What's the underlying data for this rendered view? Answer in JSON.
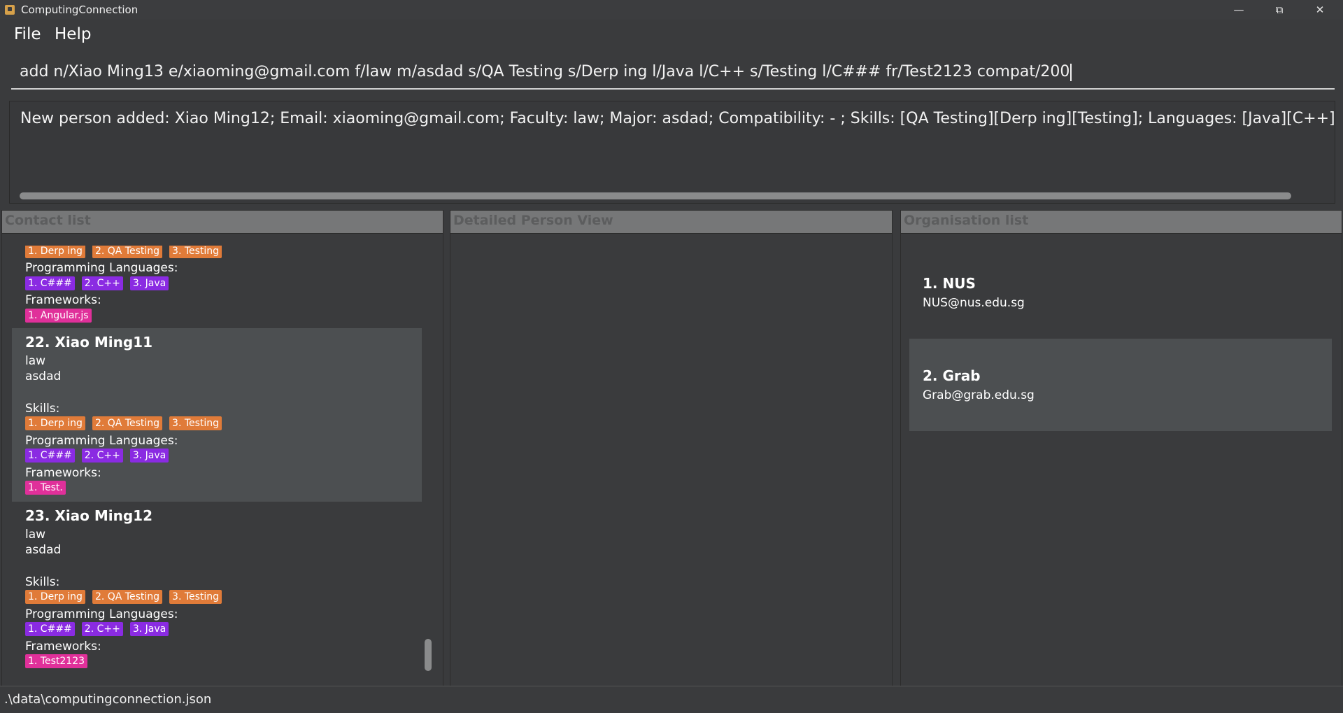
{
  "window": {
    "title": "ComputingConnection",
    "minimize_icon": "minimize-icon",
    "maximize_icon": "restore-icon",
    "close_icon": "close-icon"
  },
  "menu": {
    "file": "File",
    "help": "Help"
  },
  "command": {
    "value": "add n/Xiao Ming13 e/xiaoming@gmail.com f/law m/asdad s/QA Testing s/Derp ing l/Java l/C++ s/Testing l/C### fr/Test2123 compat/200"
  },
  "result": {
    "text": "New person added: Xiao Ming12; Email: xiaoming@gmail.com; Faculty: law; Major: asdad; Compatibility:  - ; Skills: [QA Testing][Derp ing][Testing]; Languages: [Java][C++][C###]; Frameworks: [Test"
  },
  "panels": {
    "contact_list": "Contact list",
    "detail_view": "Detailed Person View",
    "org_list": "Organisation list"
  },
  "partial_contact": {
    "skills": [
      "1. Derp ing",
      "2. QA Testing",
      "3. Testing"
    ],
    "languages_label": "Programming Languages:",
    "languages": [
      "1. C###",
      "2. C++",
      "3. Java"
    ],
    "frameworks_label": "Frameworks:",
    "frameworks": [
      "1. Angular.js"
    ]
  },
  "contacts": [
    {
      "name": "22.  Xiao Ming11",
      "faculty": "law",
      "major": "asdad",
      "skills_label": "Skills:",
      "skills": [
        "1. Derp ing",
        "2. QA Testing",
        "3. Testing"
      ],
      "languages_label": "Programming Languages:",
      "languages": [
        "1. C###",
        "2. C++",
        "3. Java"
      ],
      "frameworks_label": "Frameworks:",
      "frameworks": [
        "1. Test."
      ]
    },
    {
      "name": "23.  Xiao Ming12",
      "faculty": "law",
      "major": "asdad",
      "skills_label": "Skills:",
      "skills": [
        "1. Derp ing",
        "2. QA Testing",
        "3. Testing"
      ],
      "languages_label": "Programming Languages:",
      "languages": [
        "1. C###",
        "2. C++",
        "3. Java"
      ],
      "frameworks_label": "Frameworks:",
      "frameworks": [
        "1. Test2123"
      ]
    }
  ],
  "organisations": [
    {
      "name": "1.  NUS",
      "email": "NUS@nus.edu.sg"
    },
    {
      "name": "2.  Grab",
      "email": "Grab@grab.edu.sg"
    }
  ],
  "status": {
    "path": ".\\data\\computingconnection.json"
  },
  "colors": {
    "skill_tag": "#e07b39",
    "language_tag": "#8a2be2",
    "framework_tag": "#e0309a",
    "background": "#3a3b3d",
    "selected_card": "#4c4f51"
  }
}
